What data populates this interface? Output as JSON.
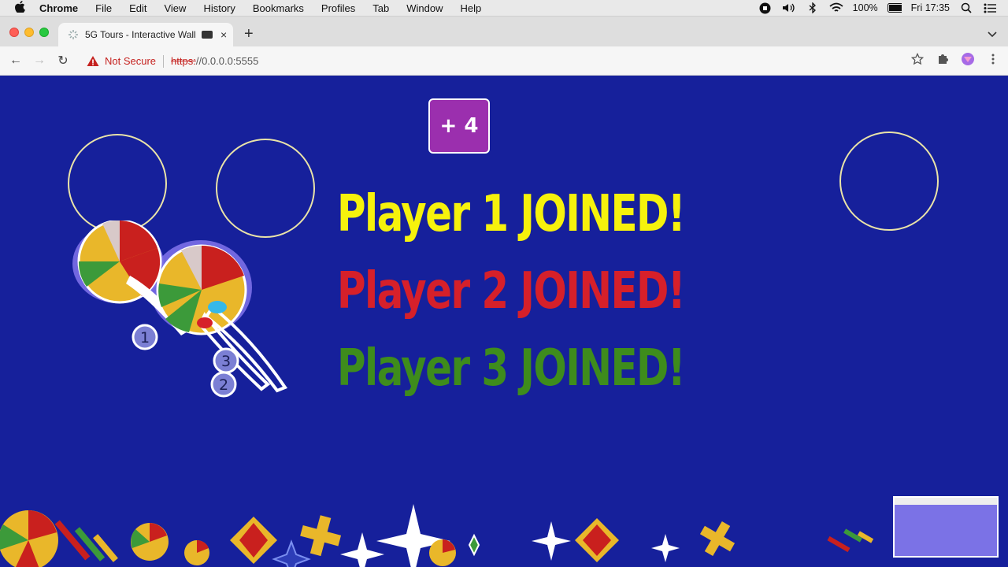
{
  "menubar": {
    "app_name": "Chrome",
    "items": [
      "File",
      "Edit",
      "View",
      "History",
      "Bookmarks",
      "Profiles",
      "Tab",
      "Window",
      "Help"
    ],
    "battery": "100%",
    "clock": "Fri 17:35"
  },
  "tab": {
    "title": "5G Tours - Interactive Wall",
    "close": "×",
    "new_tab": "+"
  },
  "toolbar": {
    "back": "←",
    "forward": "→",
    "reload": "↻",
    "security_label": "Not Secure",
    "url_scheme": "https:",
    "url_rest": "//0.0.0.0:5555"
  },
  "page": {
    "add_button_label": "+ 4",
    "player1": "Player 1 JOINED!",
    "player2": "Player 2 JOINED!",
    "player3": "Player 3 JOINED!",
    "badges": [
      "1",
      "3",
      "2"
    ],
    "colors": {
      "background": "#16209b",
      "player1": "#f6f20c",
      "player2": "#d6202a",
      "player3": "#3e8c1c",
      "add_button": "#9b2fae"
    }
  }
}
